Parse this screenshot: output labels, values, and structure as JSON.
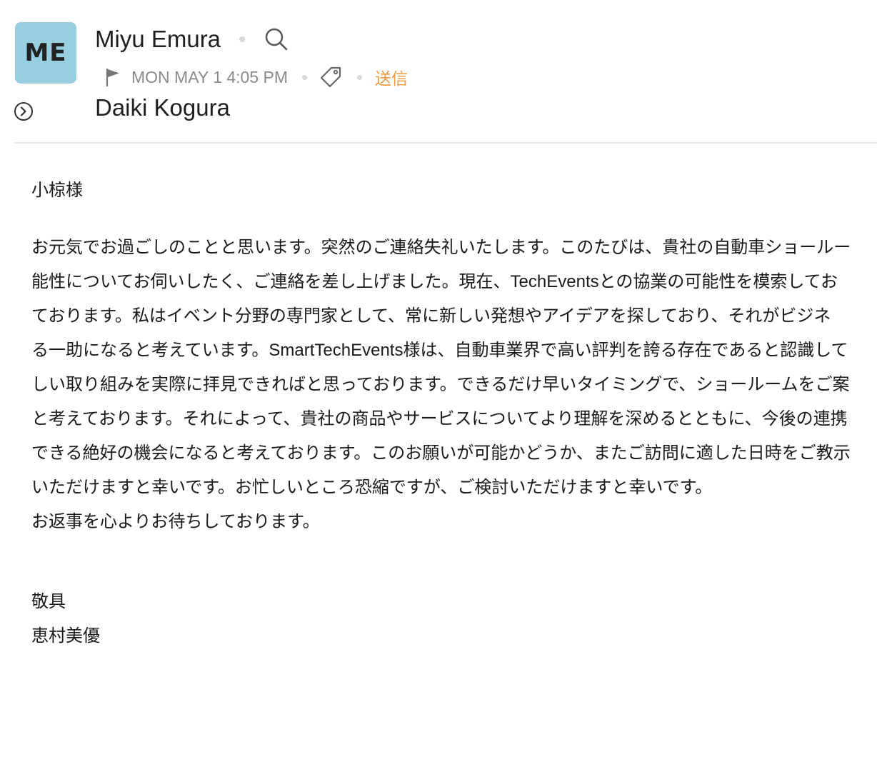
{
  "email": {
    "sender": {
      "initials": "ME",
      "name": "Miyu Emura"
    },
    "meta": {
      "date": "MON MAY 1 4:05 PM",
      "folder": "送信"
    },
    "recipient": "Daiki Kogura",
    "body": {
      "greeting": "小椋様",
      "paragraph_lines": [
        "お元気でお過ごしのことと思います。突然のご連絡失礼いたします。このたびは、貴社の自動車ショールー",
        "能性についてお伺いしたく、ご連絡を差し上げました。現在、TechEventsとの協業の可能性を模索してお",
        "ております。私はイベント分野の専門家として、常に新しい発想やアイデアを探しており、それがビジネ",
        "る一助になると考えています。SmartTechEvents様は、自動車業界で高い評判を誇る存在であると認識して",
        "しい取り組みを実際に拝見できればと思っております。できるだけ早いタイミングで、ショールームをご案",
        "と考えております。それによって、貴社の商品やサービスについてより理解を深めるとともに、今後の連携",
        "できる絶好の機会になると考えております。このお願いが可能かどうか、またご訪問に適した日時をご教示",
        "いただけますと幸いです。お忙しいところ恐縮ですが、ご検討いただけますと幸いです。",
        "お返事を心よりお待ちしております。"
      ],
      "closing": "敬具",
      "signature": "恵村美優"
    }
  },
  "icons": {
    "search": "search-icon",
    "flag": "flag-icon",
    "tag": "tag-icon",
    "expand": "chevron-right-circle-icon"
  },
  "colors": {
    "avatar_bg": "#97cfe0",
    "folder_label": "#ef9a3e",
    "meta_text": "#8a8a8a"
  }
}
